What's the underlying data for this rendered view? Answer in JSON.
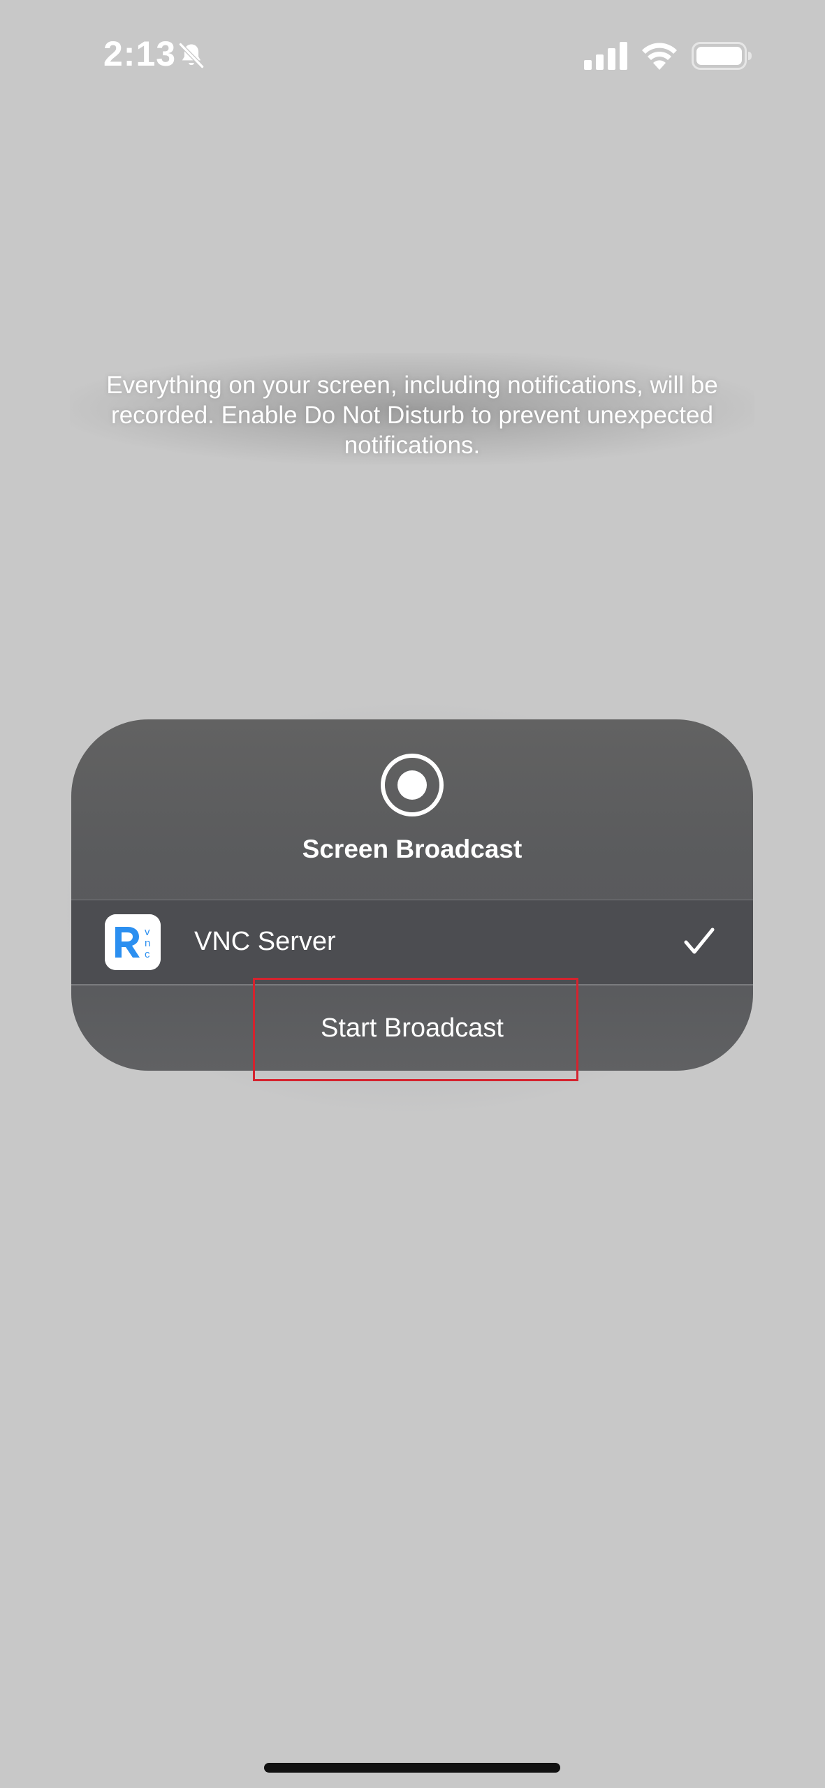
{
  "status_bar": {
    "time": "2:13",
    "silent_icon": "bell-slash-icon",
    "signal_icon": "cellular-signal-icon",
    "wifi_icon": "wifi-icon",
    "battery_icon": "battery-icon"
  },
  "notice": {
    "text": "Everything on your screen, including notifications, will be recorded. Enable Do Not Disturb to prevent unexpected notifications."
  },
  "sheet": {
    "icon": "record-icon",
    "title": "Screen Broadcast",
    "items": [
      {
        "name": "VNC Server",
        "icon": "vnc-app-icon",
        "selected": true,
        "check_icon": "checkmark-icon"
      }
    ],
    "start_label": "Start Broadcast"
  },
  "colors": {
    "background": "#c8c8c8",
    "sheet": "#5a5b5d",
    "selected_row": "#4c4d51",
    "highlight": "#d5232e",
    "vnc_blue": "#2b8ff0"
  }
}
